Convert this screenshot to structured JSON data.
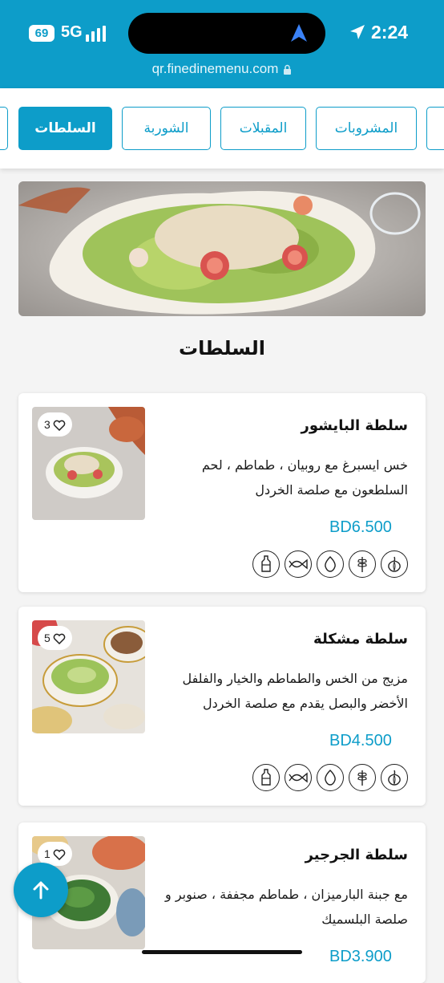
{
  "status_bar": {
    "battery": "69",
    "network": "5G",
    "time": "2:24",
    "url": "qr.finedinemenu.com"
  },
  "tabs": [
    {
      "label": "المشروبات",
      "active": false
    },
    {
      "label": "المقبلات",
      "active": false
    },
    {
      "label": "الشوربة",
      "active": false
    },
    {
      "label": "السلطات",
      "active": true
    }
  ],
  "section_title": "السلطات",
  "items": [
    {
      "name": "سلطة البايشور",
      "description": "خس ايسبرغ مع روبيان ، طماطم ، لحم السلطعون مع صلصة الخردل",
      "price": "BD6.500",
      "likes": "3",
      "allergens": [
        "garlic-icon",
        "wheat-icon",
        "egg-icon",
        "fish-icon",
        "bottle-icon"
      ]
    },
    {
      "name": "سلطة مشكلة",
      "description": "مزيج من الخس والطماطم والخيار والفلفل الأخضر والبصل يقدم مع صلصة الخردل",
      "price": "BD4.500",
      "likes": "5",
      "allergens": [
        "garlic-icon",
        "wheat-icon",
        "egg-icon",
        "fish-icon",
        "bottle-icon"
      ]
    },
    {
      "name": "سلطة الجرجير",
      "description": "مع جبنة البارميزان ، طماطم مجففة ، صنوبر و صلصة البلسميك",
      "price": "BD3.900",
      "likes": "1",
      "allergens": []
    }
  ],
  "colors": {
    "accent": "#0d9dc9"
  }
}
